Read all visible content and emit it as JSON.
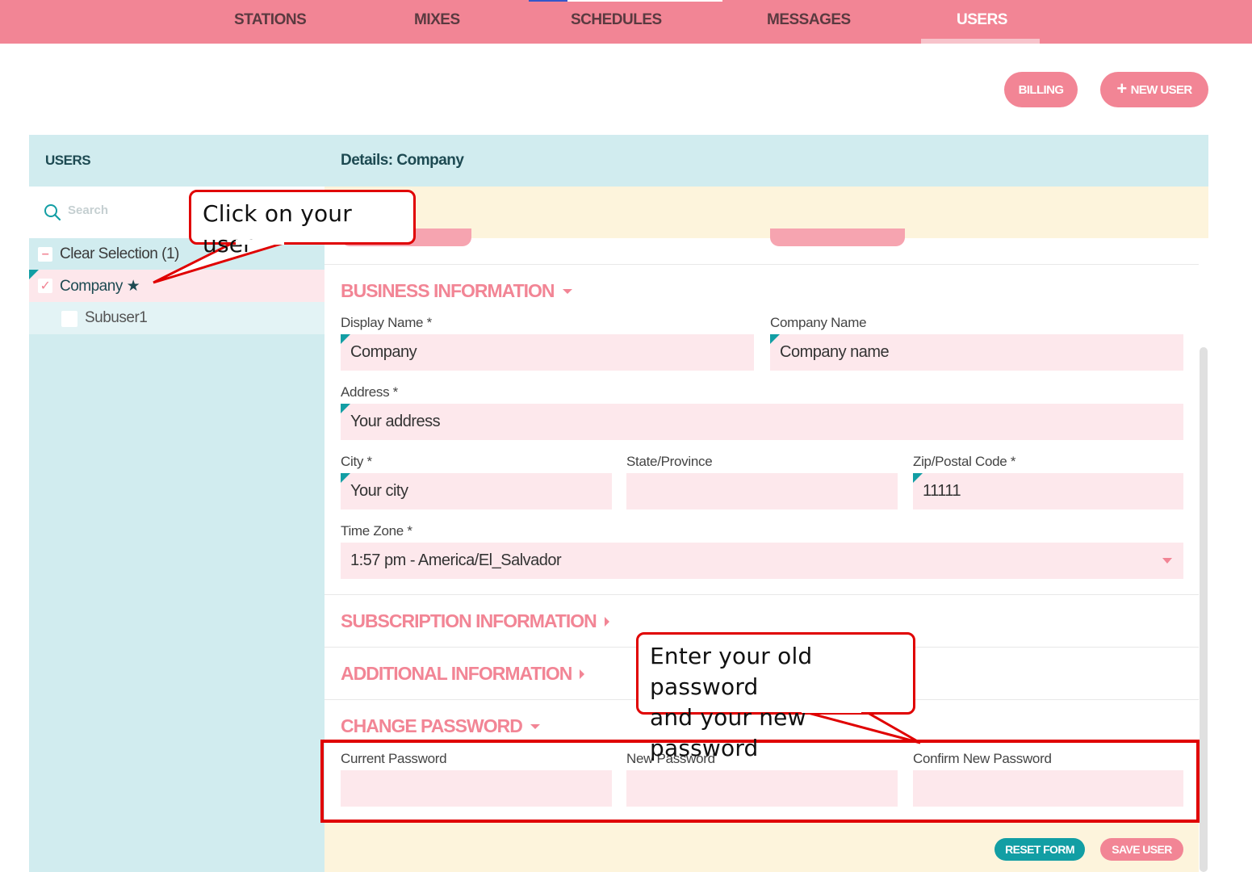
{
  "nav": {
    "tabs": [
      {
        "label": "STATIONS"
      },
      {
        "label": "MIXES"
      },
      {
        "label": "SCHEDULES"
      },
      {
        "label": "MESSAGES"
      },
      {
        "label": "USERS"
      }
    ],
    "active": "USERS"
  },
  "toolbar": {
    "billing_label": "BILLING",
    "new_user_label": "NEW USER"
  },
  "users_panel": {
    "title": "USERS",
    "search_placeholder": "Search",
    "clear_selection": "Clear Selection (1)",
    "items": [
      {
        "label": "Company ★",
        "selected": true
      },
      {
        "label": "Subuser1",
        "selected": false
      }
    ]
  },
  "details": {
    "title": "Details: Company",
    "business": {
      "title": "BUSINESS INFORMATION",
      "display_name_label": "Display Name *",
      "display_name_value": "Company",
      "company_name_label": "Company Name",
      "company_name_value": "Company name",
      "address_label": "Address *",
      "address_value": "Your address",
      "city_label": "City *",
      "city_value": "Your city",
      "state_label": "State/Province",
      "state_value": "",
      "zip_label": "Zip/Postal Code *",
      "zip_value": "11111",
      "timezone_label": "Time Zone *",
      "timezone_value": "1:57 pm - America/El_Salvador"
    },
    "subscription_title": "SUBSCRIPTION INFORMATION",
    "additional_title": "ADDITIONAL INFORMATION",
    "password": {
      "title": "CHANGE PASSWORD",
      "current_label": "Current Password",
      "new_label": "New Password",
      "confirm_label": "Confirm New Password"
    },
    "reset_label": "RESET FORM",
    "save_label": "SAVE USER"
  },
  "annotations": {
    "callout_user": "Click on your user",
    "callout_password_line1": "Enter your old password",
    "callout_password_line2": "and your new password"
  },
  "colors": {
    "brand_pink": "#f28595",
    "panel_teal": "#d1ecef",
    "accent_teal": "#129ea4",
    "annotation_red": "#e00000"
  }
}
